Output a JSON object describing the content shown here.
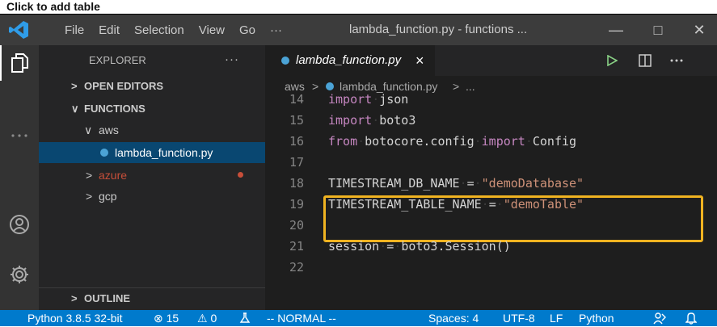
{
  "caption": "Click to add table",
  "titlebar": {
    "menu": [
      "File",
      "Edit",
      "Selection",
      "View",
      "Go",
      "···"
    ],
    "title": "lambda_function.py - functions ...",
    "minimize": "—",
    "maximize": "□",
    "close": "✕"
  },
  "sidebar": {
    "title": "EXPLORER",
    "more": "···",
    "open_editors": "OPEN EDITORS",
    "functions": "FUNCTIONS",
    "outline": "OUTLINE",
    "chev_right": ">",
    "chev_down": "∨",
    "tree": [
      {
        "label": "aws"
      },
      {
        "label": "lambda_function.py"
      },
      {
        "label": "azure"
      },
      {
        "label": "gcp"
      }
    ]
  },
  "editor": {
    "tab_label": "lambda_function.py",
    "tab_close": "×",
    "breadcrumb": {
      "folder": "aws",
      "sep": ">",
      "file": "lambda_function.py",
      "more": "..."
    },
    "lines": [
      {
        "n": "14"
      },
      {
        "n": "15"
      },
      {
        "n": "16"
      },
      {
        "n": "17"
      },
      {
        "n": "18"
      },
      {
        "n": "19"
      },
      {
        "n": "20"
      },
      {
        "n": "21"
      },
      {
        "n": "22"
      }
    ],
    "tokens": {
      "import": "import",
      "from": "from",
      "json": "json",
      "boto3": "boto3",
      "botocore": "botocore.config",
      "config": "Config",
      "db_var": "TIMESTREAM_DB_NAME",
      "tbl_var": "TIMESTREAM_TABLE_NAME",
      "eq": "=",
      "db_val": "\"demoDatabase\"",
      "tbl_val": "\"demoTable\"",
      "session_var": "session",
      "session_call": "boto3.Session()"
    },
    "highlight_color": "#f0b321"
  },
  "statusbar": {
    "python": "Python 3.8.5 32-bit",
    "errors": "⊗ 15",
    "warnings": "⚠ 0",
    "mode": "-- NORMAL --",
    "spaces": "Spaces: 4",
    "encoding": "UTF-8",
    "eol": "LF",
    "language": "Python"
  },
  "colors": {
    "accent": "#007acc",
    "keyword": "#c586c0",
    "string": "#ce9178",
    "selection": "#094771"
  }
}
